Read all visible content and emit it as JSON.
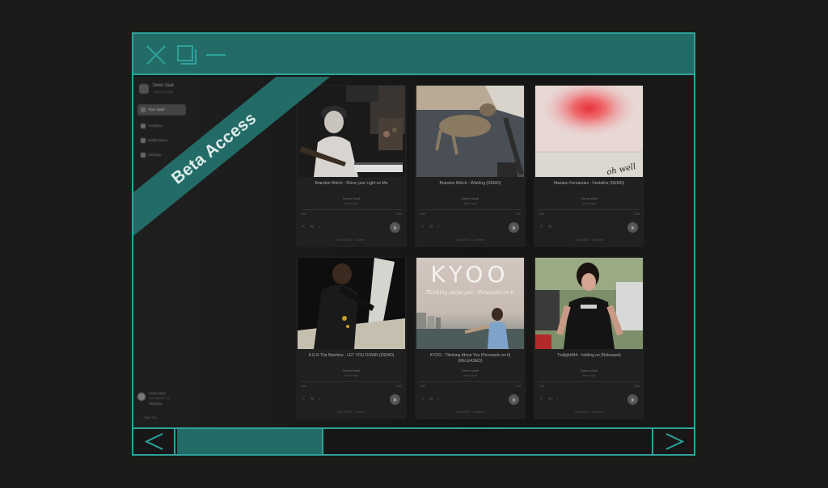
{
  "ribbon": {
    "text": "Beta Access"
  },
  "sidebar": {
    "workspace_name": "Demo Vault",
    "workspace_sub": "Vault manager",
    "items": [
      {
        "label": "Your Vault",
        "active": true
      },
      {
        "label": "Analytics",
        "active": false
      },
      {
        "label": "Notifications",
        "active": false
      },
      {
        "label": "Settings",
        "active": false
      }
    ],
    "user": {
      "name": "Demo Vault",
      "email": "demo@vault.org",
      "badge": "PREMIUM"
    },
    "signout": "Sign Out"
  },
  "cards": [
    {
      "title": "Brandon Welch - Shine your Light on Me",
      "artist": "Demo Vault",
      "sub": "demo.mp3",
      "time_start": "0:00",
      "time_end": "3:32",
      "meta": "Last 8/9/23 · 3 Listens"
    },
    {
      "title": "Brandon Welch - Wishing (DEMO)",
      "artist": "Demo Vault",
      "sub": "demo.mp3",
      "time_start": "0:00",
      "time_end": "3:10",
      "meta": "Last 8/9/23 · 2 Listens"
    },
    {
      "title": "Mariano Fernandez - Feelalive (DEMO)",
      "artist": "Demo Vault",
      "sub": "demo.mp3",
      "time_start": "0:00",
      "time_end": "2:58",
      "meta": "Last 8/9/23 · 5 Listens"
    },
    {
      "title": "K.E.N The Machine - LET YOU DOWN (DEMO)",
      "artist": "Demo Vault",
      "sub": "demo.mp3",
      "time_start": "0:00",
      "time_end": "3:21",
      "meta": "Last 8/9/23 · 4 Listens"
    },
    {
      "title": "KYOO - Thinking About You (Pensando en ti) (RELEASED)",
      "artist": "Demo Vault",
      "sub": "demo.mp3",
      "time_start": "0:00",
      "time_end": "2:44",
      "meta": "Last 8/9/23 · 6 Listens"
    },
    {
      "title": "Twilight444 - holding on (Released)",
      "artist": "Demo Vault",
      "sub": "demo.mp3",
      "time_start": "0:00",
      "time_end": "3:05",
      "meta": "Last 8/9/23 · 2 Listens"
    }
  ],
  "art_text": {
    "kyoo": "KYOO",
    "kyoo_script": "Thinking about you · Pensando en ti",
    "scribble": "oh well"
  },
  "colors": {
    "accent": "#2fa39b",
    "accent_dark": "#236b66",
    "background": "#1b1c19"
  },
  "icons": {
    "close": "close-icon",
    "restore": "restore-icon",
    "minimize": "minimize-icon",
    "prev": "chevron-left-icon",
    "next": "chevron-right-icon"
  }
}
